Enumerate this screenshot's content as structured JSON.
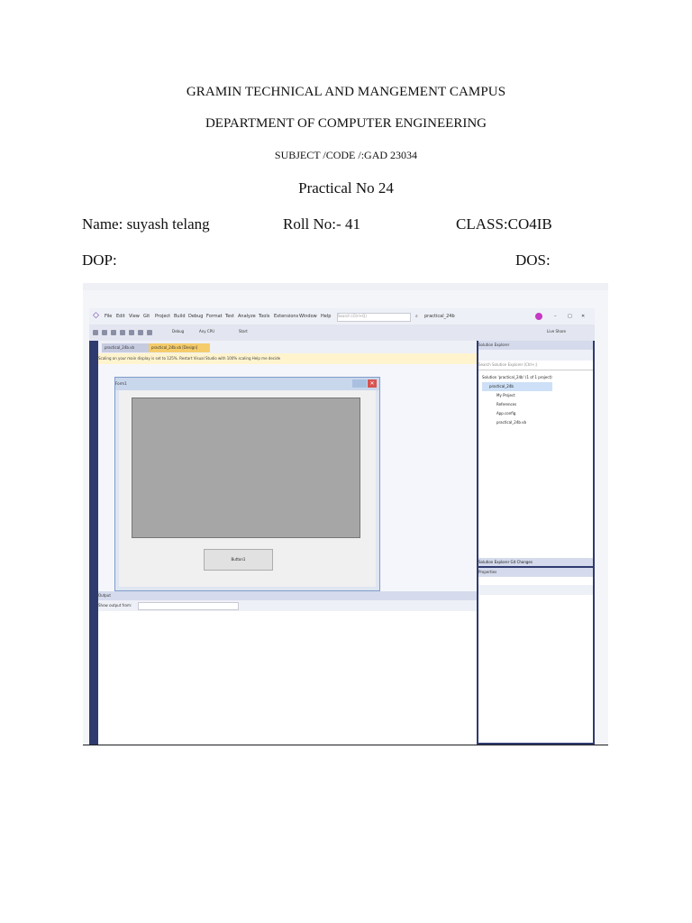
{
  "header": {
    "college": "GRAMIN TECHNICAL AND MANGEMENT CAMPUS",
    "department": "DEPARTMENT OF COMPUTER ENGINEERING",
    "subject": "SUBJECT /CODE /:GAD 23034",
    "practical": "Practical No 24"
  },
  "student": {
    "name": "Name: suyash telang",
    "roll": "Roll No:- 41",
    "class": "CLASS:CO4IB",
    "dop": "DOP:",
    "dos": "DOS:"
  },
  "screenshot": {
    "menu": [
      "File",
      "Edit",
      "View",
      "Git",
      "Project",
      "Build",
      "Debug",
      "Format",
      "Test",
      "Analyze",
      "Tools",
      "Extensions",
      "Window",
      "Help"
    ],
    "search_placeholder": "Search (Ctrl+Q)",
    "solution_name": "practical_24b",
    "toolbar": {
      "config": "Debug",
      "platform": "Any CPU",
      "start": "Start",
      "live_share": "Live Share"
    },
    "tabs": [
      "practical_24b.vb",
      "practical_24b.vb [Design]"
    ],
    "infobar": "Scaling on your main display is set to 125%.   Restart Visual Studio with 100% scaling   Help me decide",
    "form_title": "Form1",
    "button_label": "Button1",
    "output": {
      "title": "Output",
      "show_from": "Show output from:"
    },
    "solution_explorer": {
      "title": "Solution Explorer",
      "search": "Search Solution Explorer (Ctrl+;)",
      "items": [
        "Solution 'practical_24b' (1 of 1 project)",
        "practical_24b",
        "My Project",
        "References",
        "App.config",
        "practical_24b.vb"
      ],
      "tabs": [
        "Solution Explorer",
        "Git Changes"
      ]
    },
    "properties_title": "Properties"
  },
  "colors": {
    "ide_frame": "#2f3b6e",
    "tab_active": "#f5cc6b",
    "panel_gray": "#a6a6a6"
  }
}
